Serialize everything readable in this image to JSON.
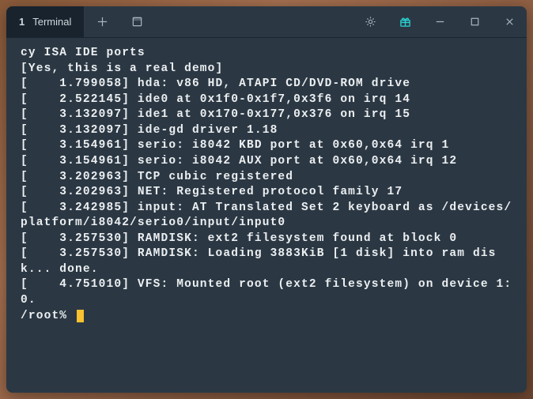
{
  "tab": {
    "number": "1",
    "title": "Terminal"
  },
  "terminal": {
    "lines": "cy ISA IDE ports\n[Yes, this is a real demo]\n[    1.799058] hda: v86 HD, ATAPI CD/DVD-ROM drive\n[    2.522145] ide0 at 0x1f0-0x1f7,0x3f6 on irq 14\n[    3.132097] ide1 at 0x170-0x177,0x376 on irq 15\n[    3.132097] ide-gd driver 1.18\n[    3.154961] serio: i8042 KBD port at 0x60,0x64 irq 1\n[    3.154961] serio: i8042 AUX port at 0x60,0x64 irq 12\n[    3.202963] TCP cubic registered\n[    3.202963] NET: Registered protocol family 17\n[    3.242985] input: AT Translated Set 2 keyboard as /devices/platform/i8042/serio0/input/input0\n[    3.257530] RAMDISK: ext2 filesystem found at block 0\n[    3.257530] RAMDISK: Loading 3883KiB [1 disk] into ram disk... done.\n[    4.751010] VFS: Mounted root (ext2 filesystem) on device 1:0.",
    "prompt": "/root% "
  }
}
